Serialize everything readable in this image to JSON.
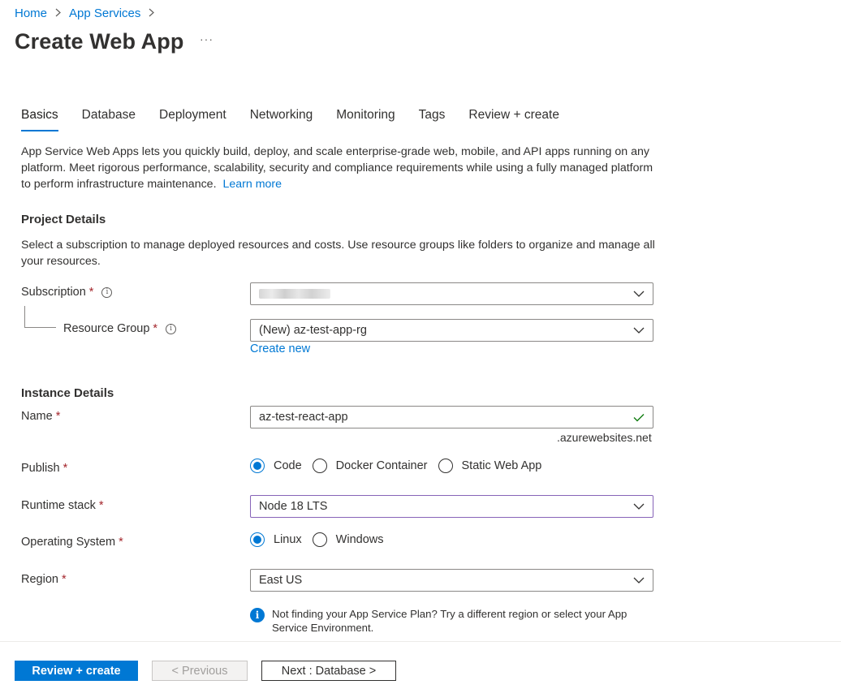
{
  "breadcrumb": {
    "home": "Home",
    "app_services": "App Services"
  },
  "page": {
    "title": "Create Web App",
    "more": "···"
  },
  "tabs": [
    "Basics",
    "Database",
    "Deployment",
    "Networking",
    "Monitoring",
    "Tags",
    "Review + create"
  ],
  "intro": {
    "text": "App Service Web Apps lets you quickly build, deploy, and scale enterprise-grade web, mobile, and API apps running on any platform. Meet rigorous performance, scalability, security and compliance requirements while using a fully managed platform to perform infrastructure maintenance.",
    "learn_more": "Learn more"
  },
  "project_details": {
    "heading": "Project Details",
    "description": "Select a subscription to manage deployed resources and costs. Use resource groups like folders to organize and manage all your resources.",
    "subscription_label": "Subscription",
    "resource_group_label": "Resource Group",
    "resource_group_value": "(New) az-test-app-rg",
    "create_new": "Create new"
  },
  "instance_details": {
    "heading": "Instance Details",
    "name_label": "Name",
    "name_value": "az-test-react-app",
    "name_suffix": ".azurewebsites.net",
    "publish_label": "Publish",
    "publish_options": [
      "Code",
      "Docker Container",
      "Static Web App"
    ],
    "publish_selected": "Code",
    "runtime_label": "Runtime stack",
    "runtime_value": "Node 18 LTS",
    "os_label": "Operating System",
    "os_options": [
      "Linux",
      "Windows"
    ],
    "os_selected": "Linux",
    "region_label": "Region",
    "region_value": "East US",
    "notice": "Not finding your App Service Plan? Try a different region or select your App Service Environment."
  },
  "required_mark": "*",
  "footer": {
    "review_create": "Review + create",
    "previous": "< Previous",
    "next": "Next : Database >"
  },
  "colors": {
    "accent": "#0078d4",
    "required": "#a4262c",
    "valid": "#107c10",
    "focus_border": "#8764b8"
  }
}
